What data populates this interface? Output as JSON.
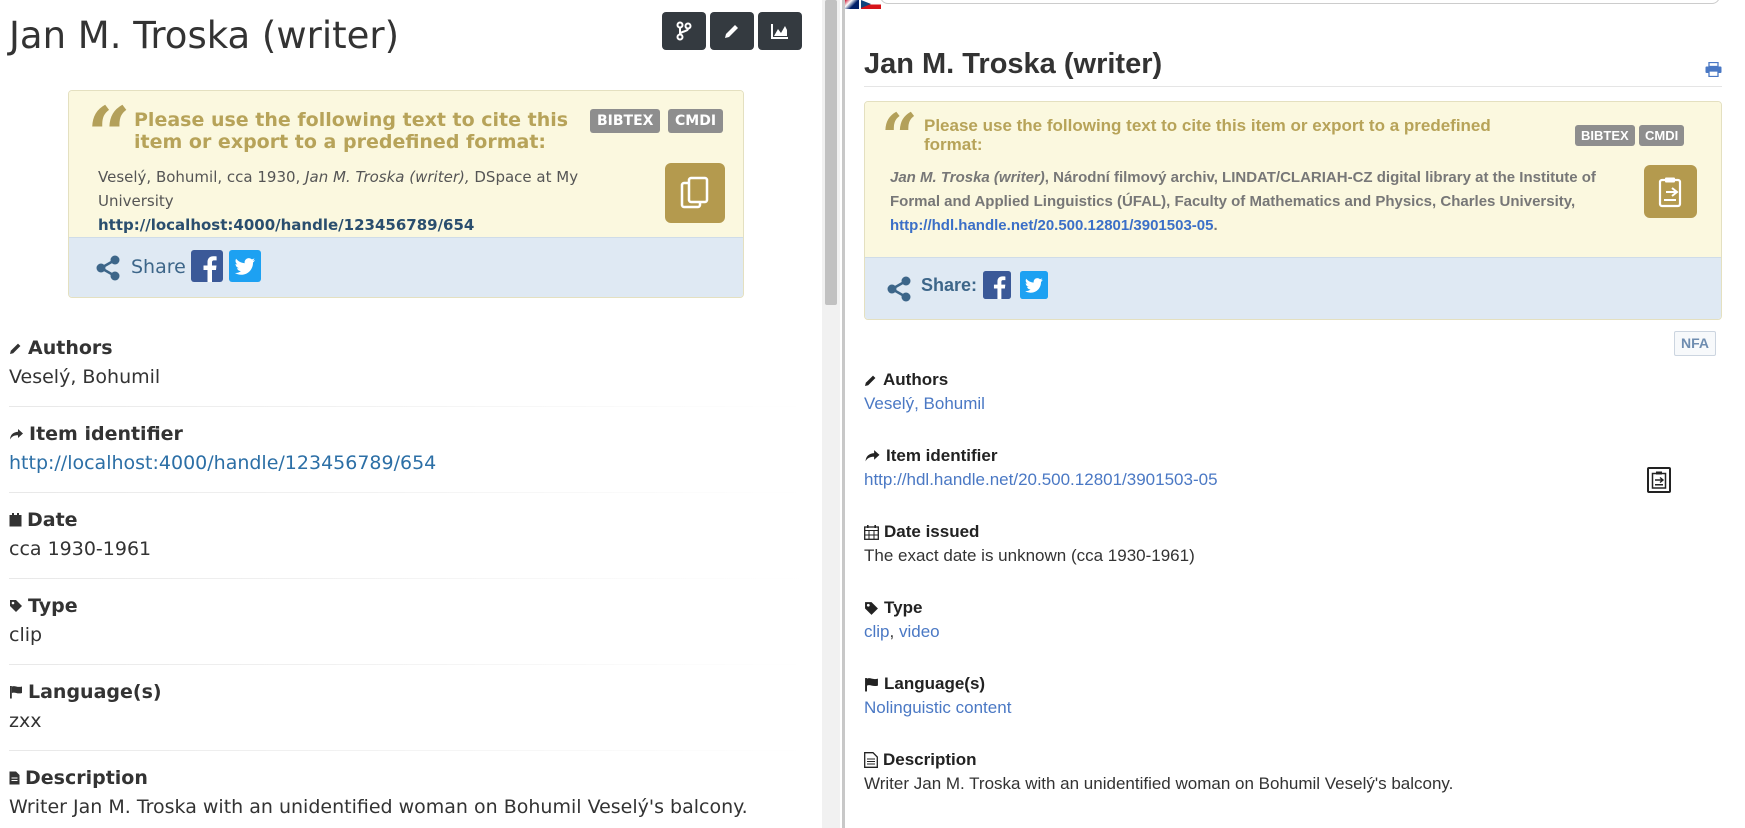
{
  "left": {
    "title": "Jan M. Troska (writer)",
    "toolbar": [
      {
        "icon": "branch-icon"
      },
      {
        "icon": "pencil-icon"
      },
      {
        "icon": "chart-icon"
      }
    ],
    "citation": {
      "heading": "Please use the following text to cite this item or export to a predefined format:",
      "bibtex": "BIBTEX",
      "cmdi": "CMDI",
      "text_prefix": "Veselý, Bohumil, cca 1930, ",
      "text_title": "Jan M. Troska (writer),",
      "text_suffix": " DSpace at My University",
      "url": "http://localhost:4000/handle/123456789/654",
      "share_label": "Share"
    },
    "fields": {
      "authors_label": "Authors",
      "authors_value": "Veselý, Bohumil",
      "identifier_label": "Item identifier",
      "identifier_value": "http://localhost:4000/handle/123456789/654",
      "date_label": "Date",
      "date_value": "cca 1930-1961",
      "type_label": "Type",
      "type_value": "clip",
      "language_label": "Language(s)",
      "language_value": "zxx",
      "description_label": "Description",
      "description_value": "Writer Jan M. Troska with an unidentified woman on Bohumil Veselý's balcony."
    }
  },
  "right": {
    "title": "Jan M. Troska (writer)",
    "citation": {
      "heading": "Please use the following text to cite this item or export to a predefined format:",
      "bibtex": "BIBTEX",
      "cmdi": "CMDI",
      "text_title": "Jan M. Troska (writer)",
      "text_body": ", Národní filmový archiv, LINDAT/CLARIAH-CZ digital library at the Institute of Formal and Applied Linguistics (ÚFAL), Faculty of Mathematics and Physics, Charles University, ",
      "url": "http://hdl.handle.net/20.500.12801/3901503-05",
      "url_suffix": ".",
      "share_label": "Share:"
    },
    "nfa_badge": "NFA",
    "fields": {
      "authors_label": "Authors",
      "authors_value": "Veselý, Bohumil",
      "identifier_label": "Item identifier",
      "identifier_value": "http://hdl.handle.net/20.500.12801/3901503-05",
      "date_label": "Date issued",
      "date_value": "The exact date is unknown (cca 1930-1961)",
      "type_label": "Type",
      "type_value_1": "clip",
      "type_sep": ", ",
      "type_value_2": "video",
      "language_label": "Language(s)",
      "language_value": "Nolinguistic content",
      "description_label": "Description",
      "description_value": "Writer Jan M. Troska with an unidentified woman on Bohumil Veselý's balcony."
    }
  },
  "colors": {
    "accent_gold": "#b7a359",
    "copy_button": "#b49a4e",
    "link_blue": "#4a78c4",
    "dark_button": "#343a40"
  }
}
